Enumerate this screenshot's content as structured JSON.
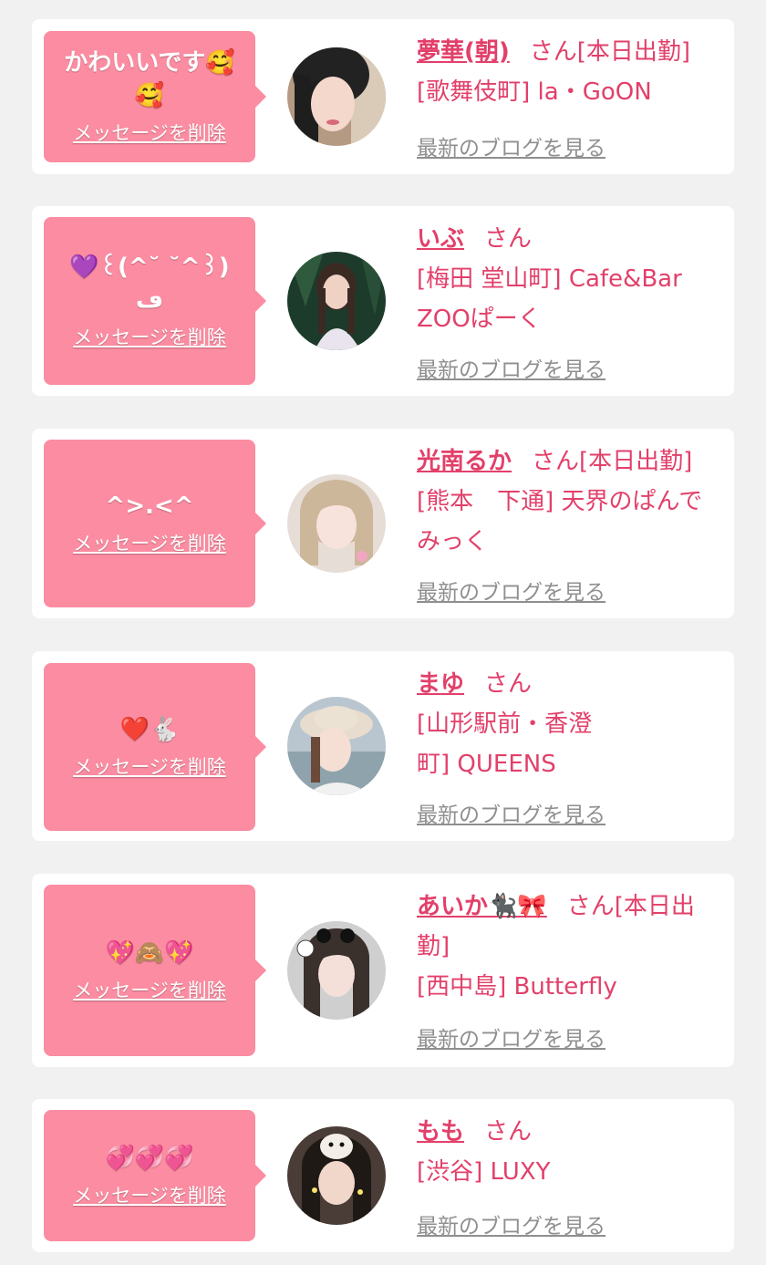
{
  "common": {
    "delete_label": "メッセージを削除",
    "blog_label": "最新のブログを見る"
  },
  "colors": {
    "background": "#f1f1f1",
    "card": "#ffffff",
    "bubble": "#fb8ca1",
    "accent": "#e2406a",
    "link_gray": "#8f8f8f"
  },
  "items": [
    {
      "message": "かわいいです🥰🥰",
      "name": "夢華(朝)",
      "suffix": "さん[本日出勤]",
      "store": "[歌舞伎町] la・GoON"
    },
    {
      "message": "💜꒰(^˘ ˘^꒱)ڡ",
      "name": "いぶ",
      "suffix": "さん",
      "store": "[梅田 堂山町] Cafe&Bar ZOOぱーく"
    },
    {
      "message": "^>.<^",
      "name": "光南るか",
      "suffix": "さん[本日出勤]",
      "store": "[熊本　下通] 天界のぱんでみっく"
    },
    {
      "message": "❤️🐇",
      "name": "まゆ",
      "suffix": "さん",
      "store": "[山形駅前・香澄町] QUEENS"
    },
    {
      "message": "💖🙈💖",
      "name": "あいか🐈‍⬛🎀",
      "suffix": "さん[本日出勤]",
      "store": "[西中島] Butterfly"
    },
    {
      "message": "💞💞💞",
      "name": "もも",
      "suffix": "さん",
      "store": "[渋谷] LUXY"
    }
  ]
}
